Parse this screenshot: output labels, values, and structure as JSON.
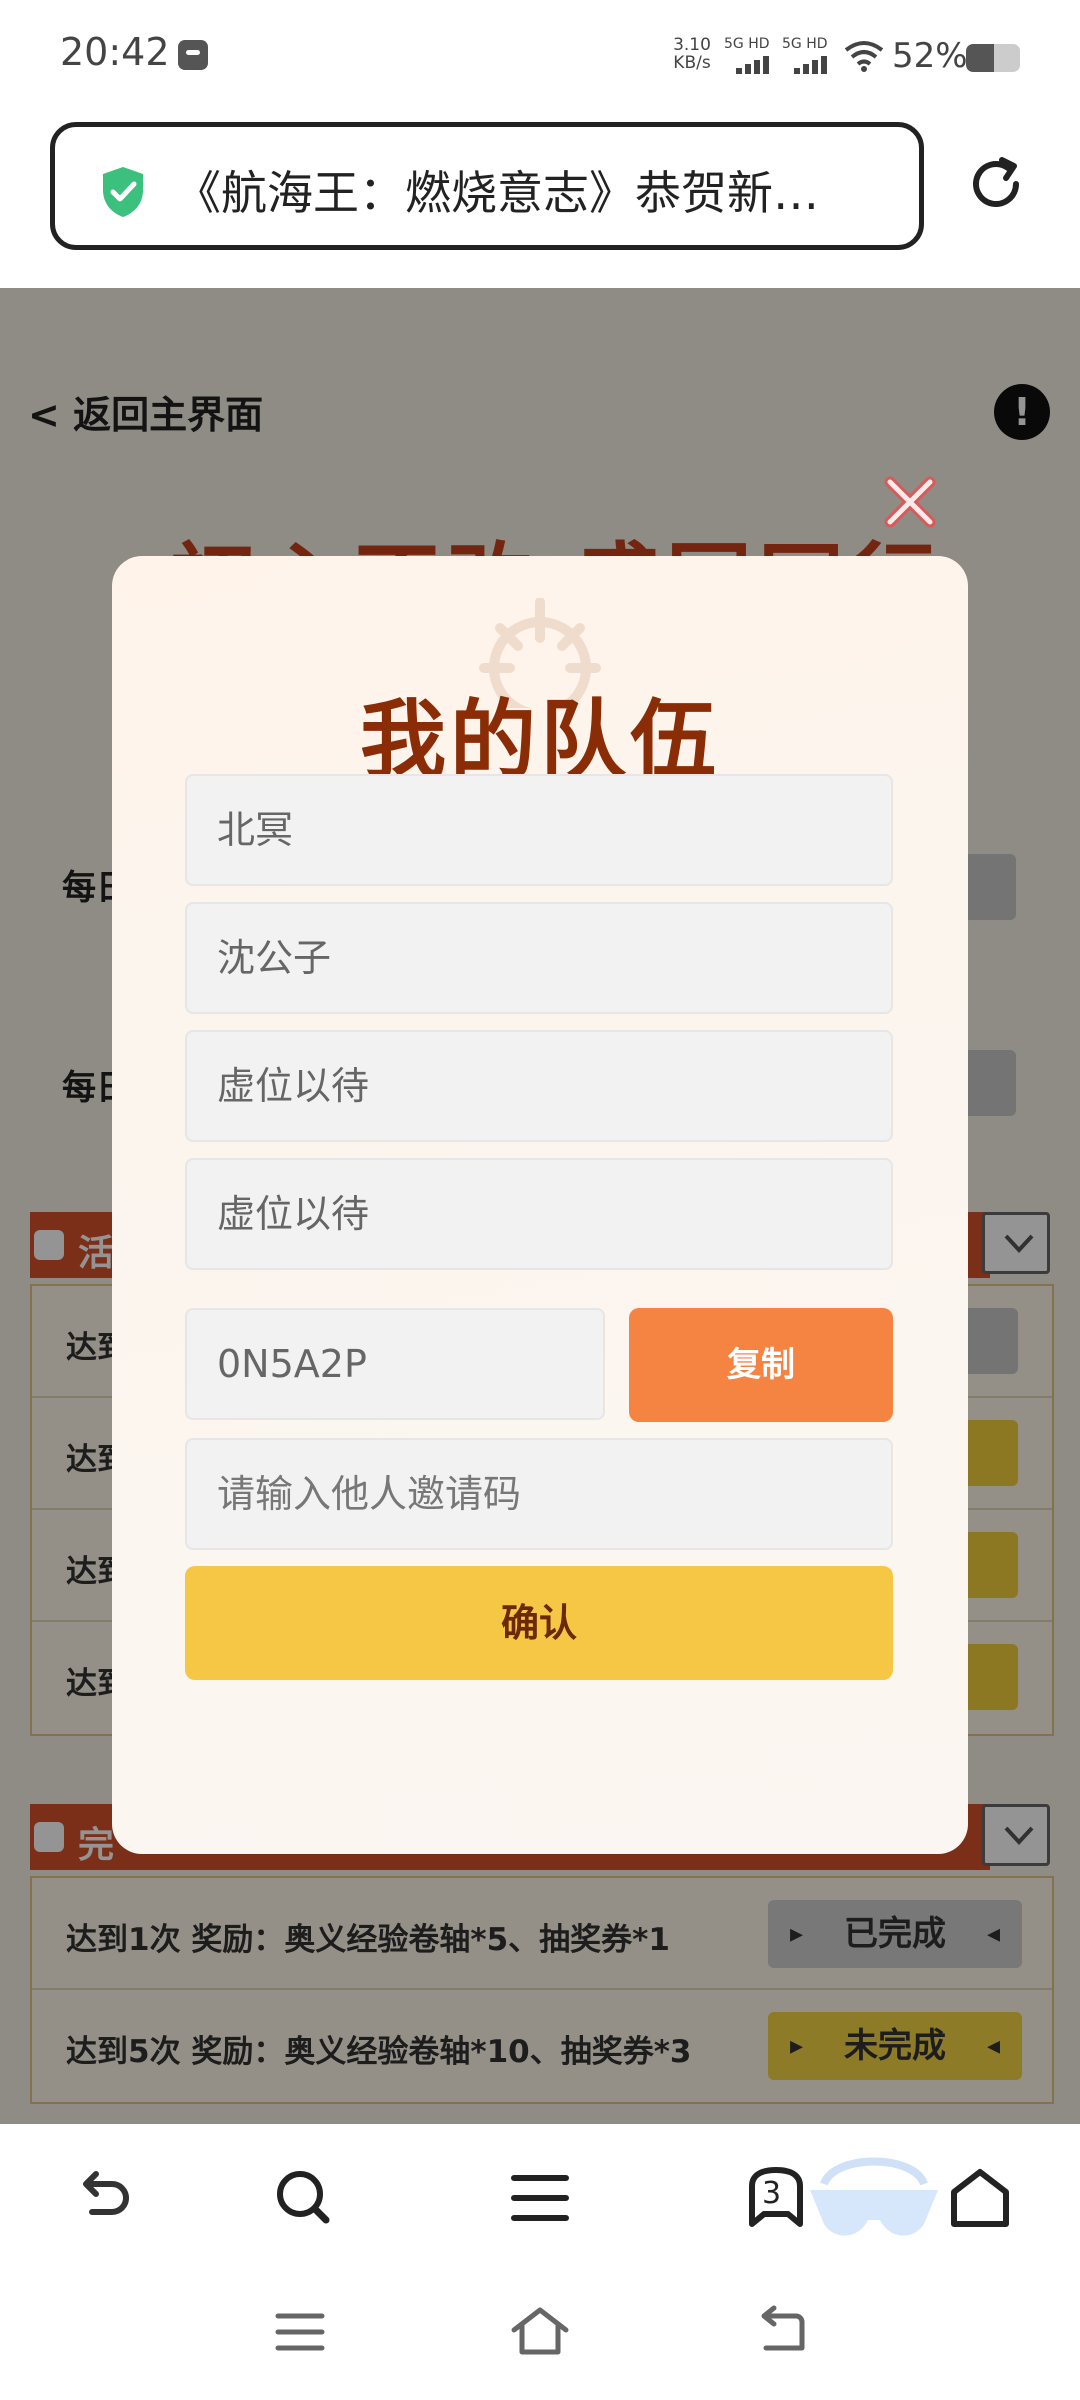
{
  "status_bar": {
    "time": "20:42",
    "net_speed_value": "3.10",
    "net_speed_unit": "KB/s",
    "net1": "5G HD",
    "net2": "5G HD",
    "battery_text": "52%",
    "battery_level": 0.52
  },
  "url_bar": {
    "title": "《航海王：燃烧意志》恭贺新…"
  },
  "page": {
    "back_link": "< 返回主界面",
    "info_symbol": "!",
    "banner_title": "初心不改 盛国同行",
    "daily_label_1": "每日",
    "daily_label_2": "每日",
    "section1_label": "活",
    "section2_label": "完",
    "rows_section1": [
      {
        "text": "达到"
      },
      {
        "text": "达到"
      },
      {
        "text": "达到"
      },
      {
        "text": "达到"
      }
    ],
    "rows_section2": [
      {
        "text": "达到1次   奖励：奥义经验卷轴*5、抽奖券*1",
        "status": "已完成"
      },
      {
        "text": "达到5次   奖励：奥义经验卷轴*10、抽奖券*3",
        "status": "未完成"
      }
    ]
  },
  "modal": {
    "title": "我的队伍",
    "members": [
      "北冥",
      "沈公子",
      "虚位以待",
      "虚位以待"
    ],
    "my_code": "0N5A2P",
    "copy_label": "复制",
    "invite_placeholder": "请输入他人邀请码",
    "confirm_label": "确认"
  },
  "browser_nav": {
    "tab_count": "3"
  },
  "colors": {
    "copy_button": "#f58342",
    "confirm_button": "#f5c744",
    "title_color": "#8a2c05",
    "shield": "#3cc07e"
  }
}
